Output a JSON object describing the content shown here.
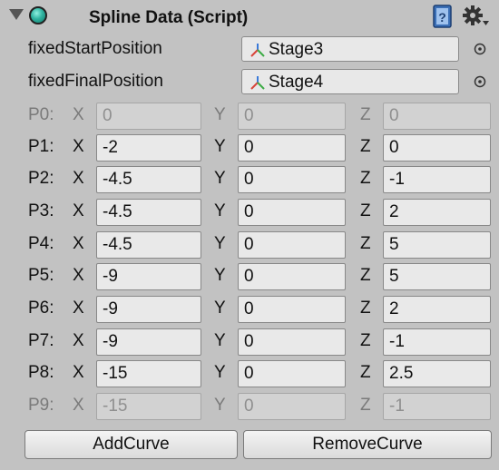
{
  "component": {
    "title": "Spline Data (Script)",
    "icon": "monobehaviour-component-icon",
    "expanded": true
  },
  "fields": [
    {
      "label": "fixedStartPosition",
      "value": "Stage3",
      "icon": "transform-icon"
    },
    {
      "label": "fixedFinalPosition",
      "value": "Stage4",
      "icon": "transform-icon"
    }
  ],
  "axis_labels": {
    "x": "X",
    "y": "Y",
    "z": "Z"
  },
  "points": [
    {
      "label": "P0:",
      "x": "0",
      "y": "0",
      "z": "0",
      "enabled": false
    },
    {
      "label": "P1:",
      "x": "-2",
      "y": "0",
      "z": "0",
      "enabled": true
    },
    {
      "label": "P2:",
      "x": "-4.5",
      "y": "0",
      "z": "-1",
      "enabled": true
    },
    {
      "label": "P3:",
      "x": "-4.5",
      "y": "0",
      "z": "2",
      "enabled": true
    },
    {
      "label": "P4:",
      "x": "-4.5",
      "y": "0",
      "z": "5",
      "enabled": true
    },
    {
      "label": "P5:",
      "x": "-9",
      "y": "0",
      "z": "5",
      "enabled": true
    },
    {
      "label": "P6:",
      "x": "-9",
      "y": "0",
      "z": "2",
      "enabled": true
    },
    {
      "label": "P7:",
      "x": "-9",
      "y": "0",
      "z": "-1",
      "enabled": true
    },
    {
      "label": "P8:",
      "x": "-15",
      "y": "0",
      "z": "2.5",
      "enabled": true
    },
    {
      "label": "P9:",
      "x": "-15",
      "y": "0",
      "z": "-1",
      "enabled": false
    }
  ],
  "buttons": {
    "add": "AddCurve",
    "remove": "RemoveCurve"
  }
}
